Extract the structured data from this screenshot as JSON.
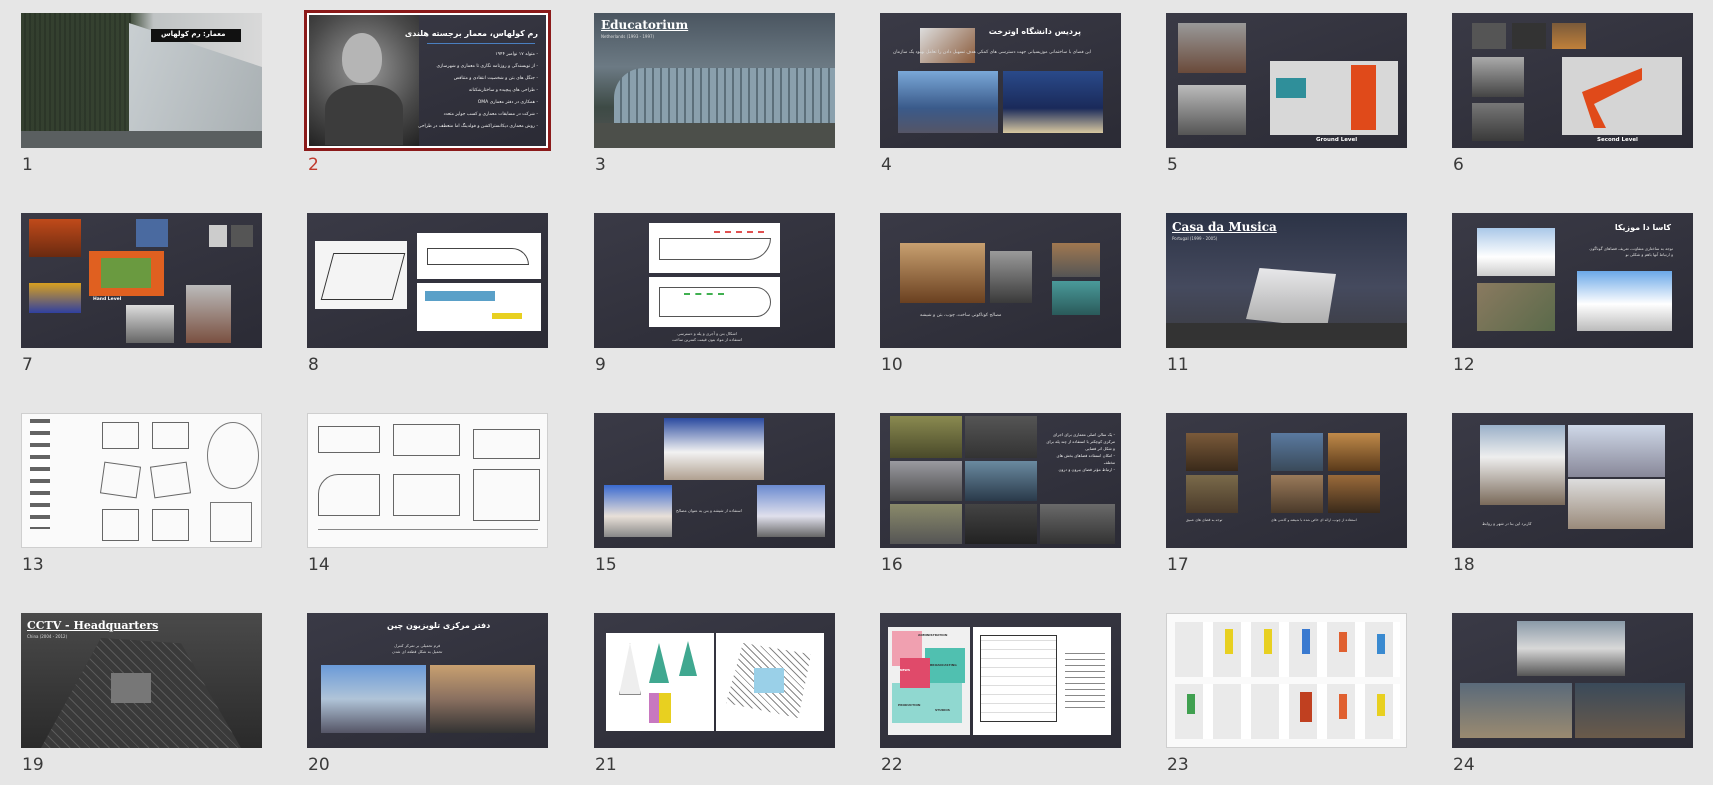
{
  "slides": [
    {
      "number": "1",
      "title": "معمار: رم کولهاس"
    },
    {
      "number": "2",
      "title": "رم کولهاس، معمار برجسته هلندی",
      "bullets": [
        "- متولد ۱۷ نوامبر ۱۹۴۴",
        "- از نویسندگی و روزنامه نگاری تا معماری و شهرسازی",
        "- جنگل های بتن و شخصیت انتقادی و متناقض",
        "- طراحی های پیچیده و ساختارشکنانه",
        "- همکاری در دفتر معماری OMA",
        "- شرکت در مسابقات معماری و کسب جوایز متعدد",
        "- روش معماری دیکانستراکشن و فولدینگ اما منعطف در طراحی"
      ]
    },
    {
      "number": "3",
      "title": "Educatorium",
      "subtitle": "Netherlands (1993 - 1997)"
    },
    {
      "number": "4",
      "title": "پردیس دانشگاه اوترخت",
      "caption": "این فضای با ساختمانی موزیسیانی جهت دسترسی های کمکی هدف تسهیل دادن را تعامل بهبود یک سازمان"
    },
    {
      "number": "5",
      "level": "Ground Level"
    },
    {
      "number": "6",
      "level": "Second Level"
    },
    {
      "number": "7",
      "level": "Hand Level"
    },
    {
      "number": "8"
    },
    {
      "number": "9",
      "caption": "اشکال بتن و آجری و پله و دسترسی\nاستفاده از مواد بتون قیمت کمترین ساخت"
    },
    {
      "number": "10",
      "caption": "مصالح کوناکونی ساخت، چوب، بتن و شیشه"
    },
    {
      "number": "11",
      "title": "Casa da Musica",
      "subtitle": "Portugal (1999 - 2005)"
    },
    {
      "number": "12",
      "title": "کاسا دا موزیکا",
      "caption": "توجه به ساختاری متفاوت، تعریف فضاهای گوناگون\nو ارتباط آنها باهم و شکلی نو"
    },
    {
      "number": "13"
    },
    {
      "number": "14"
    },
    {
      "number": "15",
      "caption": "استفاده از شیشه و بتن به عنوان مصالح"
    },
    {
      "number": "16",
      "bullets": [
        "- یک سالن اصلی معماری برای اجرای",
        "مرکزی کوچکتر با استفاده از چند پله برای",
        "و شکل اثر فضایی",
        "- امکان استفاده فضاهای بخش های",
        "مختلف",
        "- ارتباط مؤثر فضای بیرون و درون"
      ]
    },
    {
      "number": "17",
      "caption": "استفاده از چوب، ارائه ای خاص شده با شیشه و کاشی های",
      "caption2": "توجه به فضای های عمیق"
    },
    {
      "number": "18",
      "caption": "کاربرد این بنا در شهر و روابط"
    },
    {
      "number": "19",
      "title": "CCTV - Headquarters",
      "subtitle": "China (2004 - 2012)"
    },
    {
      "number": "20",
      "title": "دفتر مرکزی تلویزیون چین",
      "caption": "فرم تحمیلی بر تمرکز کنترل\nتحمیل به شکل قطعه ای شدن"
    },
    {
      "number": "21"
    },
    {
      "number": "22",
      "labels": [
        "ADMINISTRATION",
        "NEWS",
        "BROADCASTING",
        "PRODUCTION",
        "STUDIOS"
      ]
    },
    {
      "number": "23"
    },
    {
      "number": "24"
    }
  ],
  "selected_slide": "2",
  "colors": {
    "selection": "#8b1a1a",
    "selected_number": "#c0392b",
    "dark_slide": "#34343f"
  }
}
